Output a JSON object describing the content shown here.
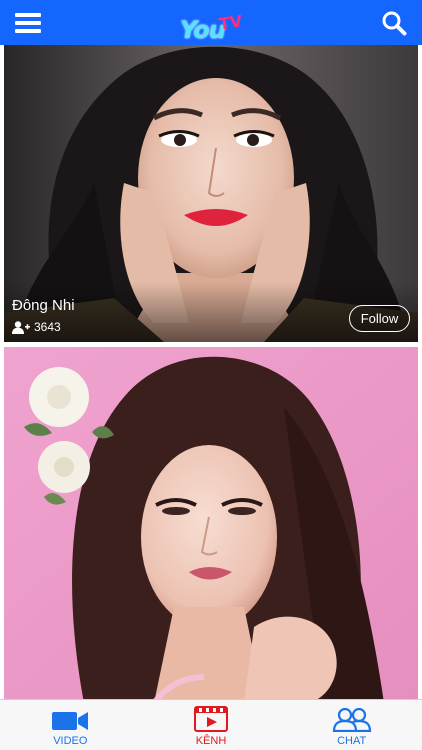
{
  "header": {
    "logo_text": "You",
    "logo_tv": "TV",
    "menu_icon": "hamburger-menu-icon",
    "search_icon": "search-icon"
  },
  "feed": [
    {
      "channel_name": "Đông Nhi",
      "followers": "3643",
      "follow_label": "Follow"
    },
    {
      "channel_name": "",
      "followers": "",
      "follow_label": ""
    }
  ],
  "tabbar": {
    "items": [
      {
        "label": "VIDEO",
        "icon": "video-camera-icon",
        "color": "#1a73e8"
      },
      {
        "label": "KÊNH",
        "icon": "film-clapper-icon",
        "color": "#e0191e",
        "active": true
      },
      {
        "label": "CHAT",
        "icon": "chat-users-icon",
        "color": "#1a73e8"
      }
    ]
  },
  "colors": {
    "header_bg": "#1565ff",
    "accent": "#1a73e8",
    "active_tab": "#e0191e"
  }
}
